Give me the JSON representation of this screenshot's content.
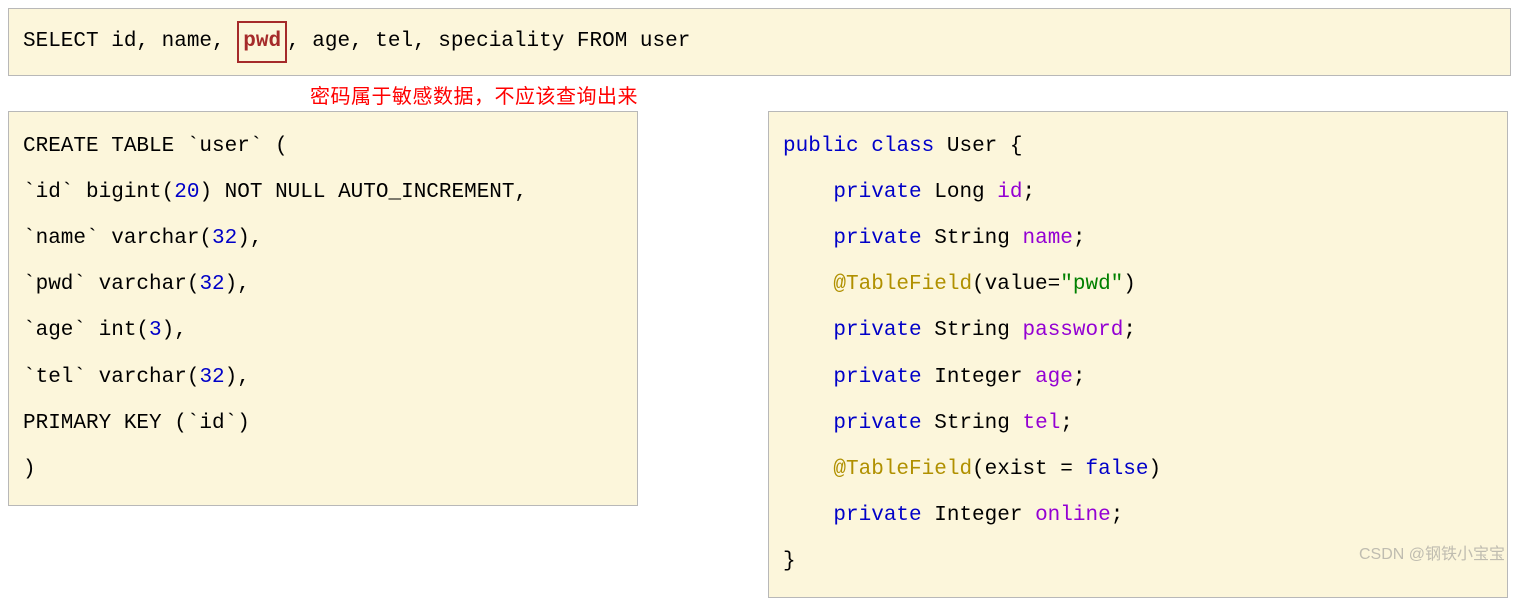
{
  "top_sql": {
    "pre": "SELECT id, name, ",
    "highlight": "pwd",
    "post": ", age, tel, speciality FROM user"
  },
  "annotation": "密码属于敏感数据，不应该查询出来",
  "sql_block": {
    "l1_a": "CREATE TABLE `user` (",
    "l2_a": "  `id` bigint(",
    "l2_n": "20",
    "l2_b": ") NOT NULL AUTO_INCREMENT,",
    "l3_a": "  `name` varchar(",
    "l3_n": "32",
    "l3_b": "),",
    "l4_a": "  `pwd` varchar(",
    "l4_n": "32",
    "l4_b": "),",
    "l5_a": "  `age` int(",
    "l5_n": "3",
    "l5_b": "),",
    "l6_a": "  `tel` varchar(",
    "l6_n": "32",
    "l6_b": "),",
    "l7_a": "  PRIMARY KEY (`id`)",
    "l8_a": ")"
  },
  "java_block": {
    "l1_kw1": "public",
    "l1_kw2": "class",
    "l1_type": "User",
    "l1_brace": " {",
    "kw_priv": "private",
    "t_Long": "Long",
    "id": "id",
    "t_String": "String",
    "name": "name",
    "anno1": "@TableField",
    "anno1_args_a": "(value=",
    "anno1_str": "\"pwd\"",
    "anno1_args_b": ")",
    "password": "password",
    "t_Integer": "Integer",
    "age": "age",
    "tel": "tel",
    "anno2": "@TableField",
    "anno2_args_a": "(exist = ",
    "anno2_kw": "false",
    "anno2_args_b": ")",
    "online": "online",
    "close": "}",
    "semi": ";"
  },
  "watermark": "CSDN @钢铁小宝宝"
}
